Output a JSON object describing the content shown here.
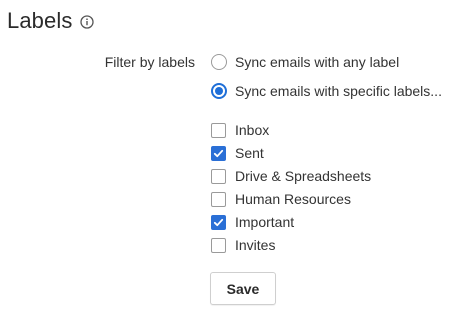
{
  "section": {
    "title": "Labels",
    "info_icon": "info-circle-icon"
  },
  "filter": {
    "label": "Filter by labels",
    "options": [
      {
        "label": "Sync emails with any label",
        "selected": false
      },
      {
        "label": "Sync emails with specific labels...",
        "selected": true
      }
    ]
  },
  "labels": [
    {
      "name": "Inbox",
      "checked": false
    },
    {
      "name": "Sent",
      "checked": true
    },
    {
      "name": "Drive & Spreadsheets",
      "checked": false
    },
    {
      "name": "Human Resources",
      "checked": false
    },
    {
      "name": "Important",
      "checked": true
    },
    {
      "name": "Invites",
      "checked": false
    }
  ],
  "actions": {
    "save_label": "Save"
  },
  "colors": {
    "accent": "#2a6fd6",
    "text": "#333333",
    "border": "#9a9a9a"
  }
}
